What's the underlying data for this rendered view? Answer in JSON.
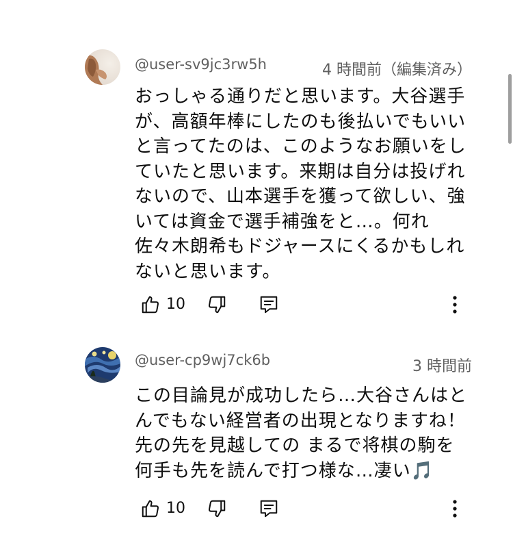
{
  "comments": [
    {
      "author": "@user-sv9jc3rw5h",
      "time": "4 時間前（編集済み）",
      "lines": [
        "おっしゃる通りだと思います。大谷選手",
        "が、高額年棒にしたのも後払いでもいい",
        "と言ってたのは、このようなお願いをし",
        "ていたと思います。来期は自分は投げれ",
        "ないので、山本選手を獲って欲しい、強",
        "いては資金で選手補強をと…。何れ",
        "佐々木朗希もドジャースにくるかもしれ",
        "ないと思います。"
      ],
      "like_count": "10",
      "avatar_icon": "avatar-icon"
    },
    {
      "author": "@user-cp9wj7ck6b",
      "time": "3 時間前",
      "lines": [
        "この目論見が成功したら…大谷さんはと",
        "んでもない経営者の出現となりますね！",
        "先の先を見越しての まるで将棋の駒を",
        "何手も先を読んで打つ様な…凄い🎵"
      ],
      "like_count": "10",
      "avatar_icon": "avatar-icon"
    }
  ],
  "icons": {
    "like": "thumbs-up-icon",
    "dislike": "thumbs-down-icon",
    "reply": "reply-icon",
    "more": "more-vert-icon"
  }
}
